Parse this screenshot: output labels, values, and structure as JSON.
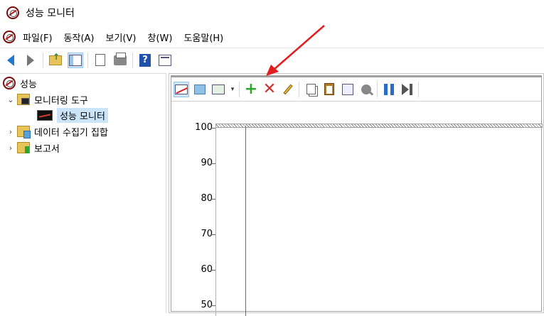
{
  "window": {
    "title": "성능 모니터"
  },
  "menu": [
    "파일(F)",
    "동작(A)",
    "보기(V)",
    "창(W)",
    "도움말(H)"
  ],
  "toolbar": {
    "icons": [
      "back-icon",
      "forward-icon",
      "up-folder-icon",
      "show-hide-console-tree-icon",
      "export-list-icon",
      "print-icon",
      "help-icon",
      "properties-icon"
    ]
  },
  "tree": {
    "root": "성능",
    "monitoring_tools": "모니터링 도구",
    "performance_monitor": "성능 모니터",
    "data_collector_sets": "데이터 수집기 집합",
    "reports": "보고서"
  },
  "perf_toolbar": {
    "icons": [
      "view-current-activity-icon",
      "change-graph-type-icon",
      "change-graph-type-dropdown-icon",
      "add-counter-icon",
      "delete-counter-icon",
      "highlight-icon",
      "copy-properties-icon",
      "paste-counter-list-icon",
      "properties-icon",
      "zoom-icon",
      "freeze-display-icon",
      "update-data-icon"
    ]
  },
  "chart_data": {
    "type": "line",
    "y_ticks": [
      "100",
      "90",
      "80",
      "70",
      "60",
      "50"
    ],
    "ylim": [
      50,
      100
    ],
    "series": []
  },
  "colors": {
    "annotation_arrow": "#e02020",
    "time_cursor": "#d04040",
    "selection": "#cce4f7"
  }
}
